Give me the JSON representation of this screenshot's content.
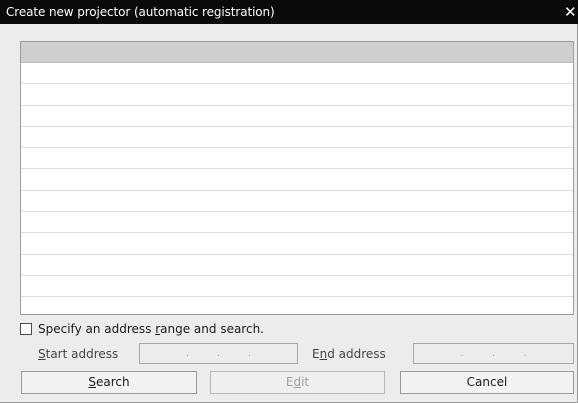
{
  "window": {
    "title": "Create new projector (automatic registration)",
    "close_glyph": "✕"
  },
  "list": {
    "header": "",
    "rows": [
      "",
      "",
      "",
      "",
      "",
      "",
      "",
      "",
      "",
      "",
      "",
      ""
    ]
  },
  "address_range": {
    "checkbox_checked": false,
    "checkbox_label": {
      "before": "Specify an address ",
      "mnemonic": "r",
      "after": "ange and search."
    },
    "start_label": {
      "before": "",
      "mnemonic": "S",
      "after": "tart address"
    },
    "end_label": {
      "before": "E",
      "mnemonic": "n",
      "after": "d address"
    },
    "start_value": [
      "",
      "",
      "",
      ""
    ],
    "end_value": [
      "",
      "",
      "",
      ""
    ]
  },
  "buttons": {
    "search": {
      "before": "",
      "mnemonic": "S",
      "after": "earch",
      "enabled": true
    },
    "edit": {
      "before": "E",
      "mnemonic": "d",
      "after": "it",
      "enabled": false
    },
    "cancel": {
      "label": "Cancel",
      "enabled": true
    }
  }
}
